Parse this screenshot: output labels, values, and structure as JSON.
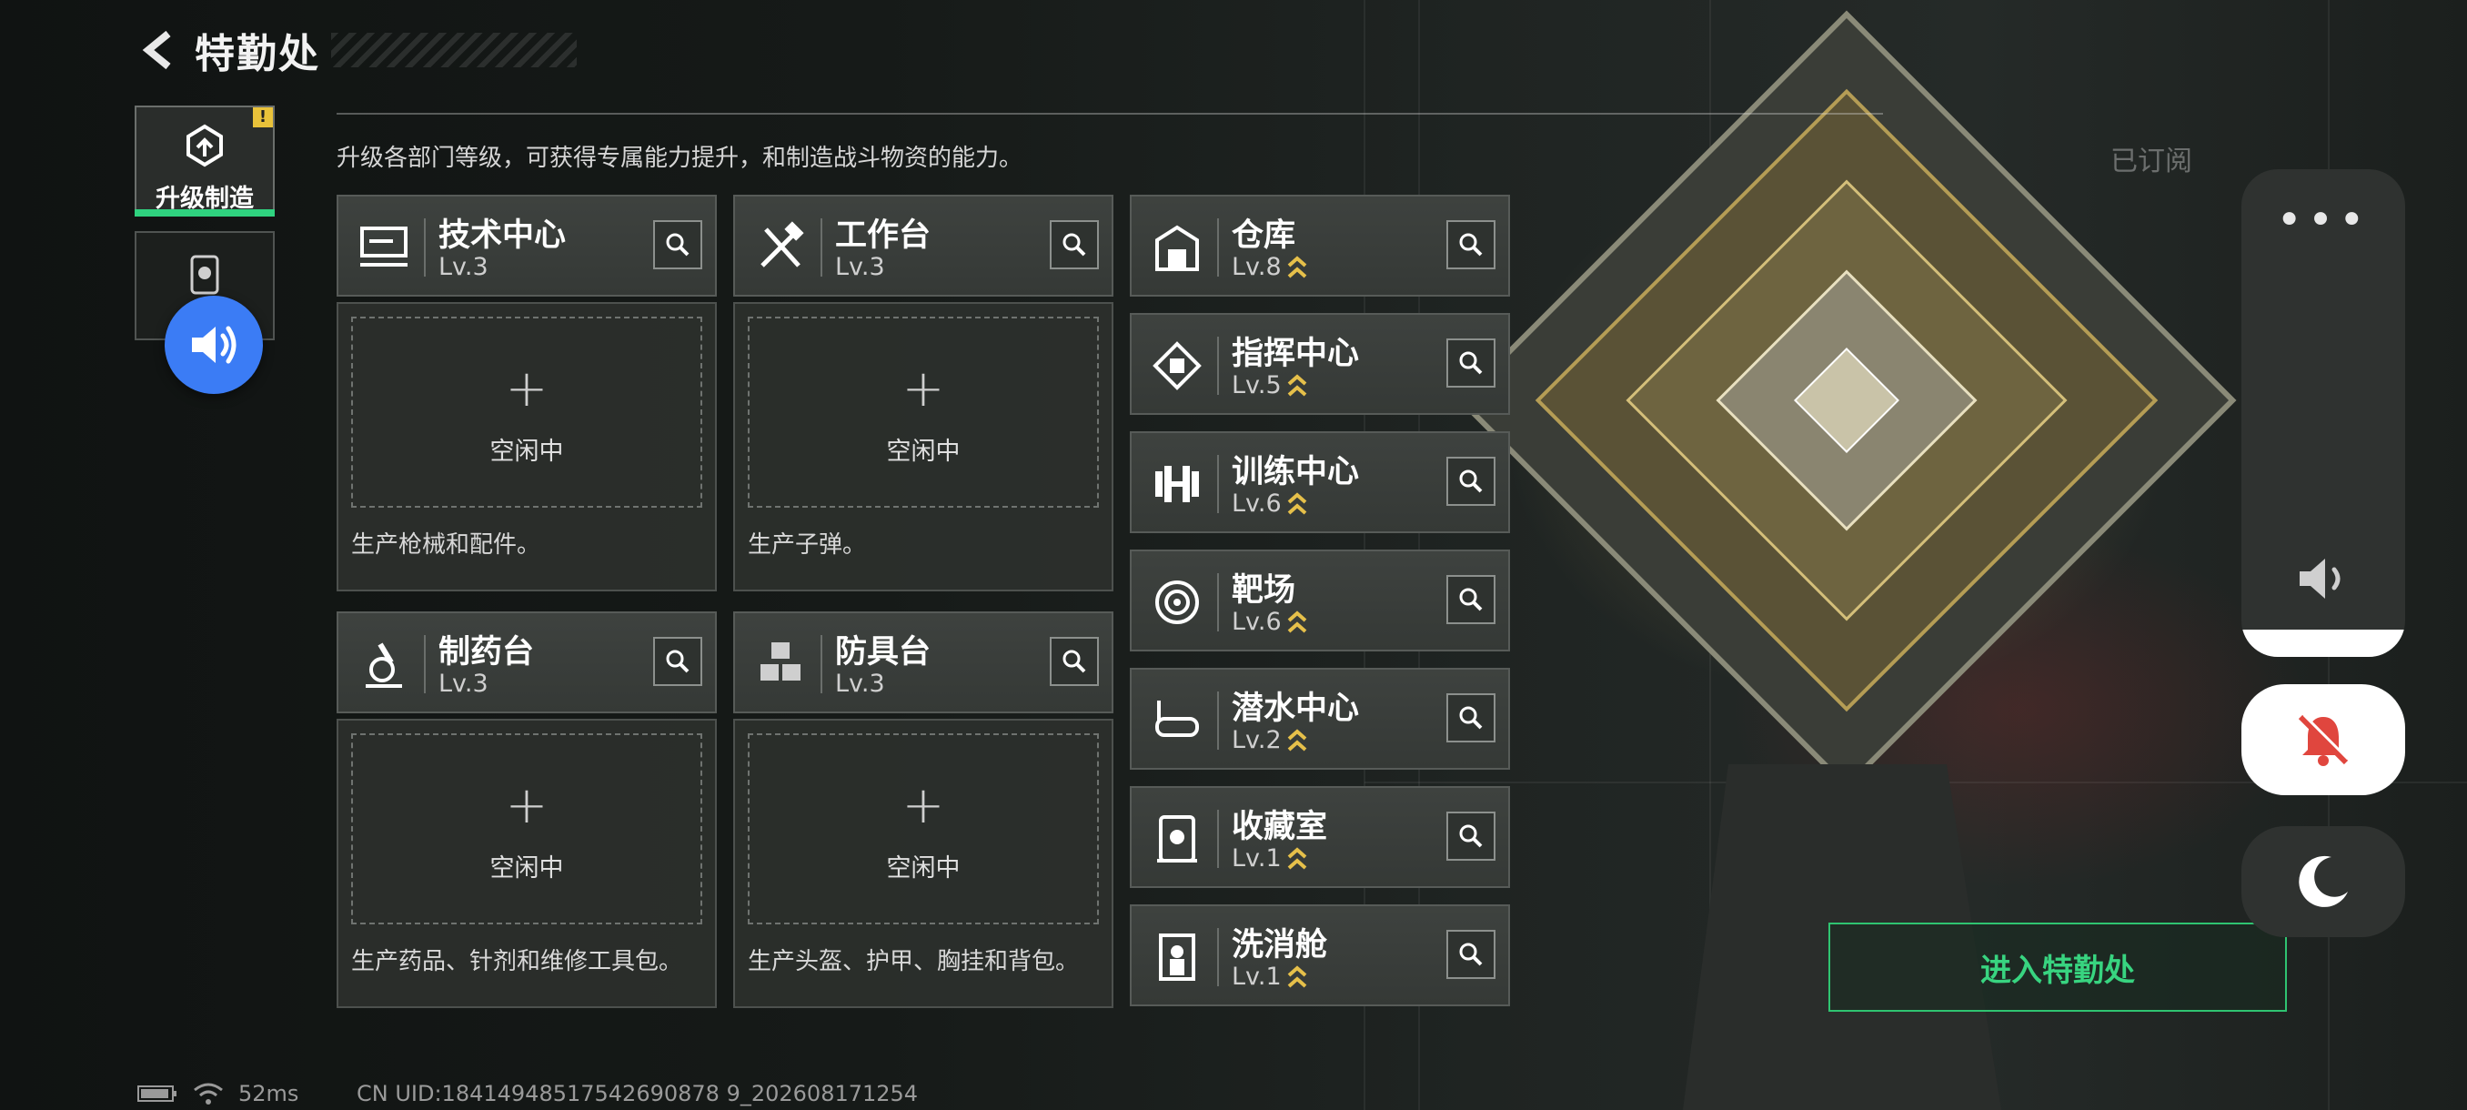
{
  "header": {
    "title": "特勤处"
  },
  "tabs": [
    {
      "label": "升级制造",
      "badge": "!",
      "active": true
    },
    {
      "label": "",
      "active": false
    }
  ],
  "description": "升级各部门等级，可获得专属能力提升，和制造战斗物资的能力。",
  "subscribed_label": "已订阅",
  "workshops": [
    {
      "name": "技术中心",
      "level": "Lv.3",
      "slot_plus": "+",
      "status": "空闲中",
      "desc": "生产枪械和配件。"
    },
    {
      "name": "工作台",
      "level": "Lv.3",
      "slot_plus": "+",
      "status": "空闲中",
      "desc": "生产子弹。"
    },
    {
      "name": "制药台",
      "level": "Lv.3",
      "slot_plus": "+",
      "status": "空闲中",
      "desc": "生产药品、针剂和维修工具包。"
    },
    {
      "name": "防具台",
      "level": "Lv.3",
      "slot_plus": "+",
      "status": "空闲中",
      "desc": "生产头盔、护甲、胸挂和背包。"
    }
  ],
  "facilities": [
    {
      "name": "仓库",
      "level": "Lv.8",
      "upgradable": true
    },
    {
      "name": "指挥中心",
      "level": "Lv.5",
      "upgradable": true
    },
    {
      "name": "训练中心",
      "level": "Lv.6",
      "upgradable": true
    },
    {
      "name": "靶场",
      "level": "Lv.6",
      "upgradable": true
    },
    {
      "name": "潜水中心",
      "level": "Lv.2",
      "upgradable": true
    },
    {
      "name": "收藏室",
      "level": "Lv.1",
      "upgradable": true
    },
    {
      "name": "洗消舱",
      "level": "Lv.1",
      "upgradable": true
    }
  ],
  "enter_button": "进入特勤处",
  "float_panel": {
    "menu": "•••"
  },
  "status_bar": {
    "ping": "52ms",
    "uid": "CN UID:18414948517542690878 9_202608171254"
  },
  "colors": {
    "accent": "#2fd27f",
    "badge": "#e9c23a",
    "upgrade_chevron": "#e6c04a",
    "bubble": "#3b7cf5",
    "mute_red": "#e0463e"
  }
}
